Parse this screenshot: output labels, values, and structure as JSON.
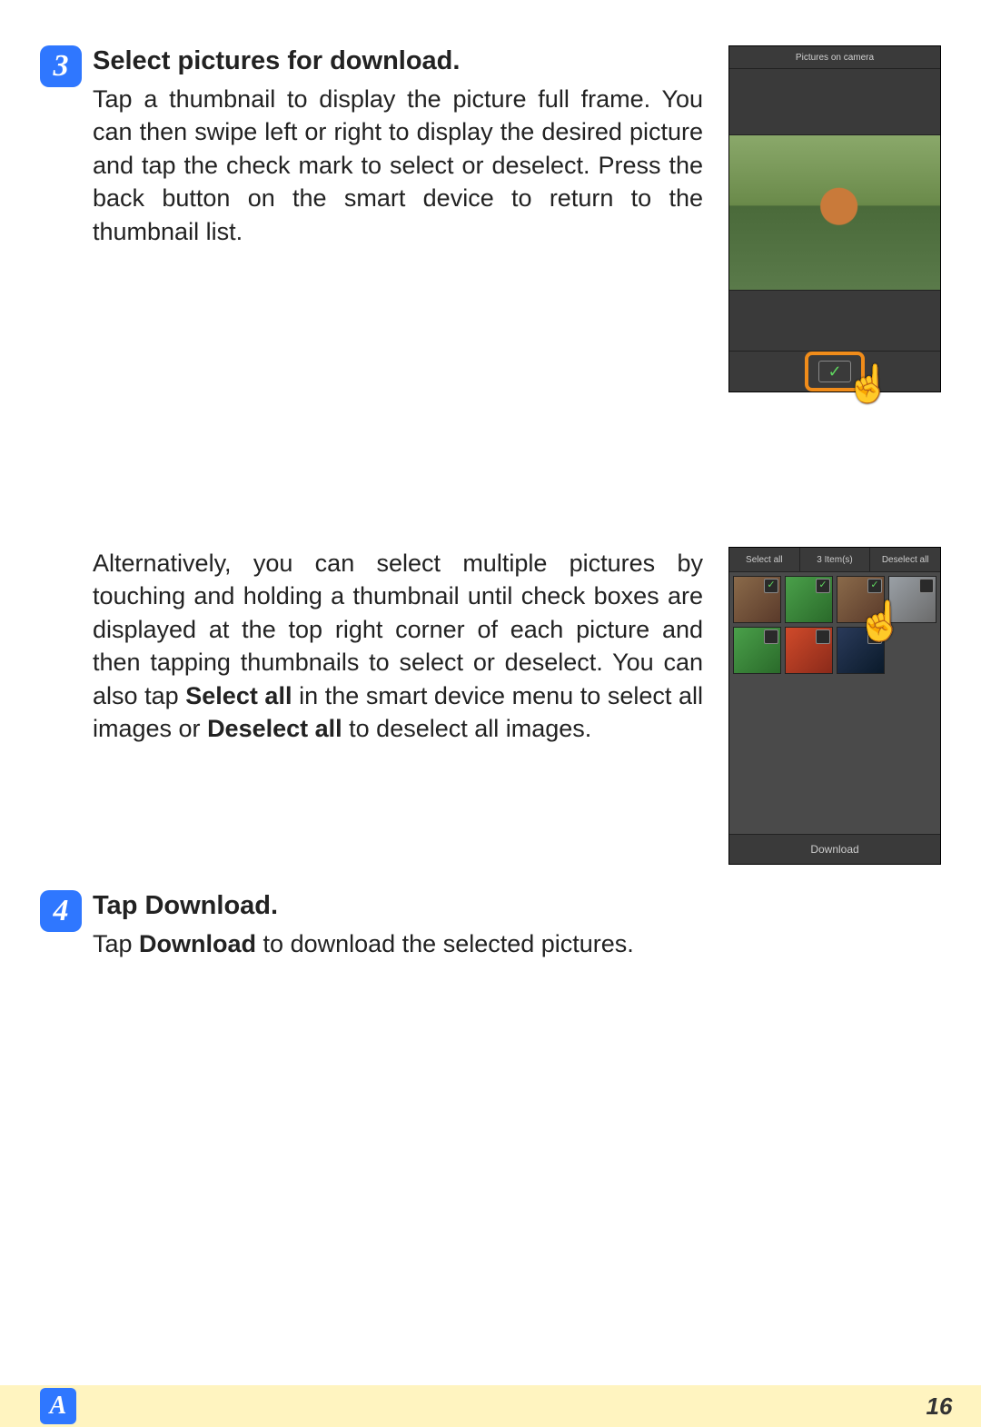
{
  "step3": {
    "number": "3",
    "heading": "Select pictures for download.",
    "para1": "Tap a thumbnail to display the picture full frame. You can then swipe left or right to display the desired picture and tap the check mark to select or deselect. Press the back button on the smart device to return to the thumbnail list.",
    "para2_a": "Alternatively, you can select multiple pictures by touching and holding a thumbnail until check boxes are displayed at the top right corner of each picture and then tapping thumbnails to select or deselect. You can also tap ",
    "para2_bold1": "Select all",
    "para2_b": " in the smart device menu to select all images or ",
    "para2_bold2": "Deselect all",
    "para2_c": " to deselect all images."
  },
  "phone1": {
    "title": "Pictures on camera",
    "check_glyph": "✓"
  },
  "phone2": {
    "top_left": "Select all",
    "top_mid": "3 Item(s)",
    "top_right": "Deselect all",
    "selected_count": 3,
    "thumbs": [
      {
        "cls": "brown",
        "checked": true
      },
      {
        "cls": "green",
        "checked": true
      },
      {
        "cls": "brown",
        "checked": true
      },
      {
        "cls": "gray",
        "checked": false
      },
      {
        "cls": "green",
        "checked": false
      },
      {
        "cls": "red",
        "checked": false
      },
      {
        "cls": "dark",
        "checked": false
      }
    ],
    "bottom": "Download"
  },
  "step4": {
    "number": "4",
    "heading_a": "Tap ",
    "heading_bold": "Download",
    "heading_b": ".",
    "body_a": "Tap ",
    "body_bold": "Download",
    "body_b": " to download the selected pictures."
  },
  "footer": {
    "section": "A",
    "page": "16"
  }
}
